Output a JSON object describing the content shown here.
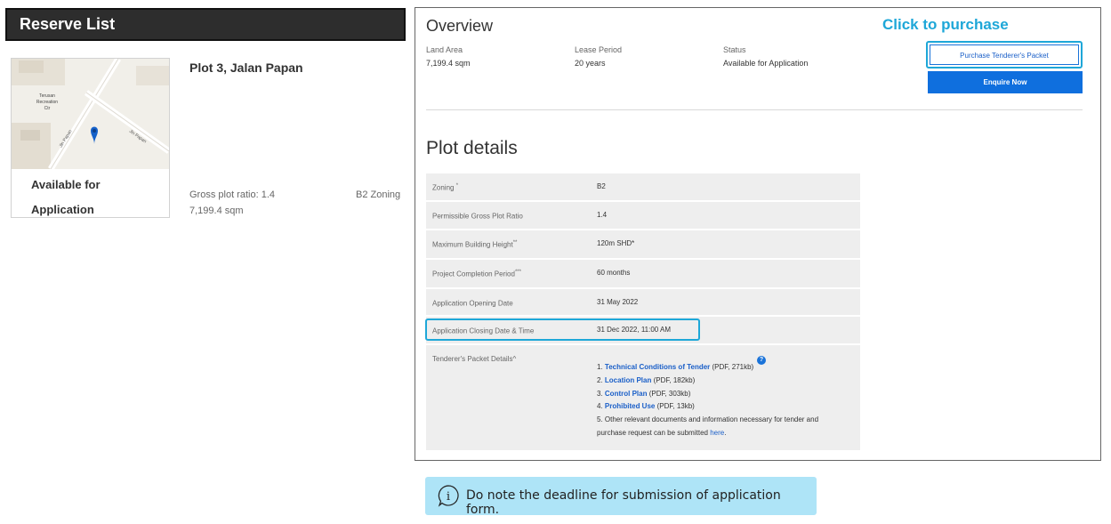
{
  "reserve_list": {
    "title": "Reserve List",
    "card": {
      "status_line1": "Available for",
      "status_line2": "Application",
      "map_labels": {
        "place_line1": "Terusan",
        "place_line2": "Recreation",
        "place_line3": "Ctr",
        "road1": "Jln Papan",
        "road2": "Jln Papan"
      }
    },
    "plot_name": "Plot 3, Jalan Papan",
    "gross_plot_ratio": "Gross plot ratio: 1.4",
    "area": "7,199.4 sqm",
    "zoning": "B2 Zoning"
  },
  "overview": {
    "title": "Overview",
    "click_label": "Click to purchase",
    "land_area_label": "Land Area",
    "land_area_value": "7,199.4 sqm",
    "lease_period_label": "Lease Period",
    "lease_period_value": "20 years",
    "status_label": "Status",
    "status_value": "Available for Application",
    "purchase_button": "Purchase Tenderer's Packet",
    "enquire_button": "Enquire Now"
  },
  "plot_details": {
    "title": "Plot details",
    "rows": [
      {
        "label": "Zoning",
        "mark": "*",
        "value": "B2"
      },
      {
        "label": "Permissible Gross Plot Ratio",
        "mark": "",
        "value": "1.4"
      },
      {
        "label": "Maximum Building Height",
        "mark": "**",
        "value": "120m SHD*"
      },
      {
        "label": "Project Completion Period",
        "mark": "***",
        "value": "60 months"
      },
      {
        "label": "Application Opening Date",
        "mark": "",
        "value": "31 May 2022"
      },
      {
        "label": "Application Closing Date & Time",
        "mark": "",
        "value": "31 Dec 2022, 11:00 AM"
      }
    ],
    "packet": {
      "label": "Tenderer's Packet Details^",
      "items": [
        {
          "num": "1.",
          "link": "Technical Conditions of Tender",
          "info": "(PDF, 271kb)"
        },
        {
          "num": "2.",
          "link": "Location Plan",
          "info": "(PDF, 182kb)"
        },
        {
          "num": "3.",
          "link": "Control Plan",
          "info": "(PDF, 303kb)"
        },
        {
          "num": "4.",
          "link": "Prohibited Use",
          "info": "(PDF, 13kb)"
        }
      ],
      "other_line1": "5. Other relevant documents and information necessary for tender and",
      "other_line2": "purchase request can be submitted",
      "here_link": "here",
      "info_icon_glyph": "?"
    }
  },
  "note": {
    "icon_glyph": "i",
    "text": "Do note the deadline for submission of application form."
  },
  "colors": {
    "accent": "#1ea7d8",
    "primary_button": "#0f6fde",
    "header_bg": "#2d2d2d",
    "note_bg": "#aee4f7",
    "table_row_bg": "#eeeeee"
  }
}
